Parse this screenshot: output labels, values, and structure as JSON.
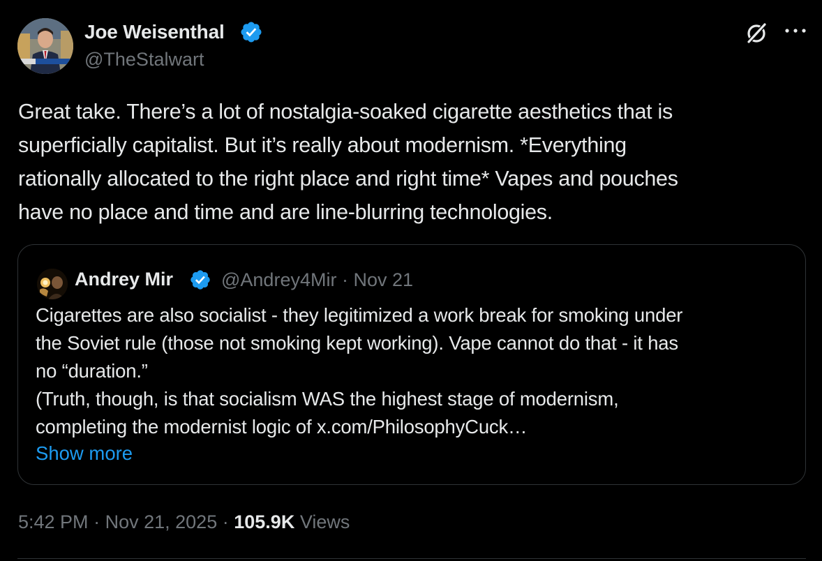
{
  "author": {
    "display_name": "Joe Weisenthal",
    "handle": "@TheStalwart",
    "verified": true,
    "avatar": "profile-photo"
  },
  "tweet": {
    "text_lines": [
      "Great take. There’s a lot of nostalgia-soaked cigarette aesthetics that is",
      "superficially capitalist. But it’s really about modernism. *Everything",
      "rationally allocated to the right place and right time* Vapes and pouches",
      "have no place and time and are line-blurring technologies."
    ]
  },
  "quote": {
    "display_name": "Andrey Mir",
    "handle": "@Andrey4Mir",
    "separator": "·",
    "date": "Nov 21",
    "verified": true,
    "text_lines": [
      "Cigarettes are also socialist - they legitimized a work break for smoking under",
      "the Soviet rule (those not smoking kept working). Vape cannot do that - it has",
      "no “duration.”",
      "(Truth, though, is that socialism WAS the highest stage of modernism,",
      "completing the modernist logic of x.com/PhilosophyCuck…"
    ],
    "show_more": "Show more"
  },
  "footer": {
    "time": "5:42 PM",
    "separator": "·",
    "date": "Nov 21, 2025",
    "views_count": "105.9K",
    "views_label": "Views"
  },
  "colors": {
    "background": "#000000",
    "text_primary": "#e7e9ea",
    "text_secondary": "#71767b",
    "accent_blue": "#1d9bf0",
    "border": "#2f3336"
  },
  "icons": {
    "verified": "verified-badge-icon",
    "grok": "grok-icon",
    "more": "more-horizontal-icon"
  }
}
